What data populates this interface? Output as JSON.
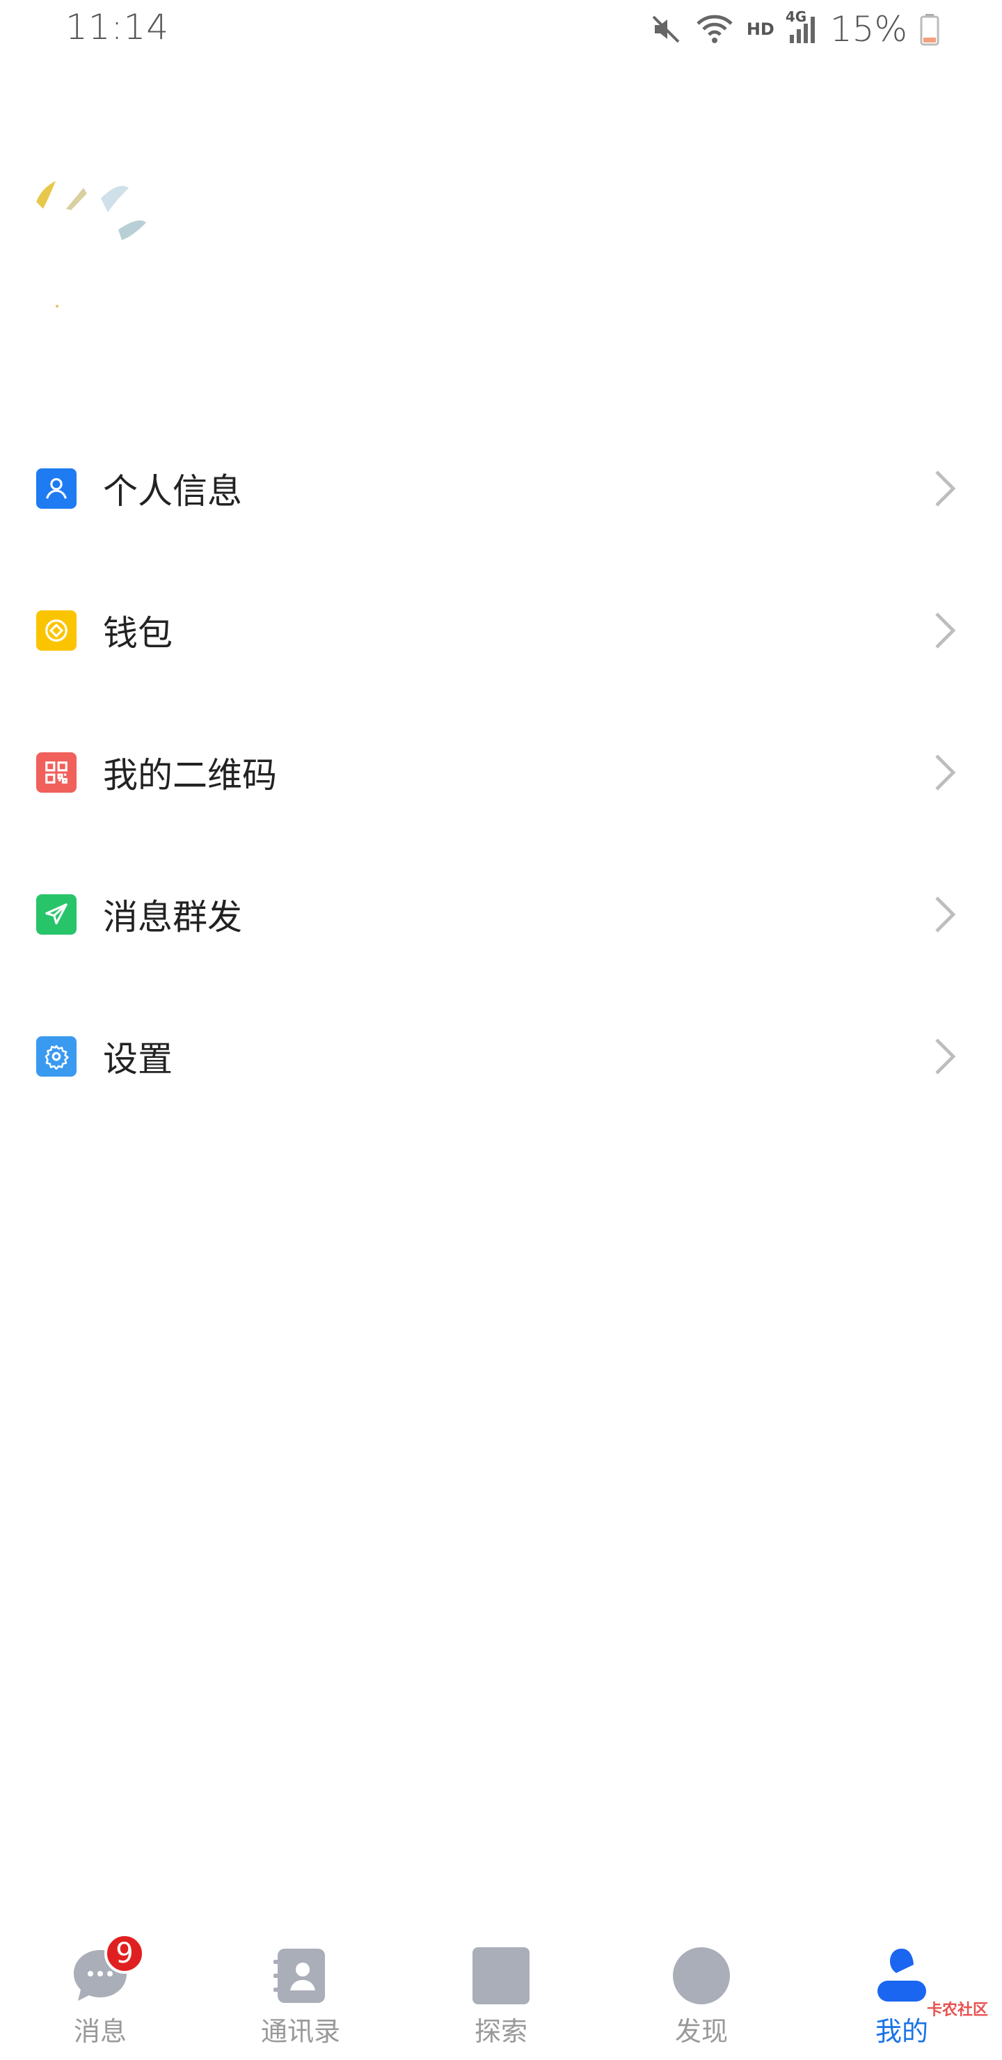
{
  "status_bar": {
    "time": "11:14",
    "network": "HD",
    "signal": "4G",
    "battery": "15%",
    "icons": [
      "mute-icon",
      "wifi-icon",
      "signal-icon",
      "battery-icon"
    ]
  },
  "menu": {
    "items": [
      {
        "label": "个人信息",
        "icon": "person-icon",
        "color": "#1e7bf2"
      },
      {
        "label": "钱包",
        "icon": "wallet-icon",
        "color": "#fbc400"
      },
      {
        "label": "我的二维码",
        "icon": "qrcode-icon",
        "color": "#f1605b"
      },
      {
        "label": "消息群发",
        "icon": "send-icon",
        "color": "#27c46a"
      },
      {
        "label": "设置",
        "icon": "gear-icon",
        "color": "#3a9af0"
      }
    ]
  },
  "bottom_nav": {
    "items": [
      {
        "label": "消息",
        "icon": "chat-icon",
        "badge": "9"
      },
      {
        "label": "通讯录",
        "icon": "contacts-icon"
      },
      {
        "label": "探索",
        "icon": "explore-icon"
      },
      {
        "label": "发现",
        "icon": "discover-icon"
      },
      {
        "label": "我的",
        "icon": "profile-icon",
        "active": true
      }
    ],
    "active_color": "#1a73e8",
    "inactive_color": "#999999"
  },
  "watermark": "卡农社区"
}
